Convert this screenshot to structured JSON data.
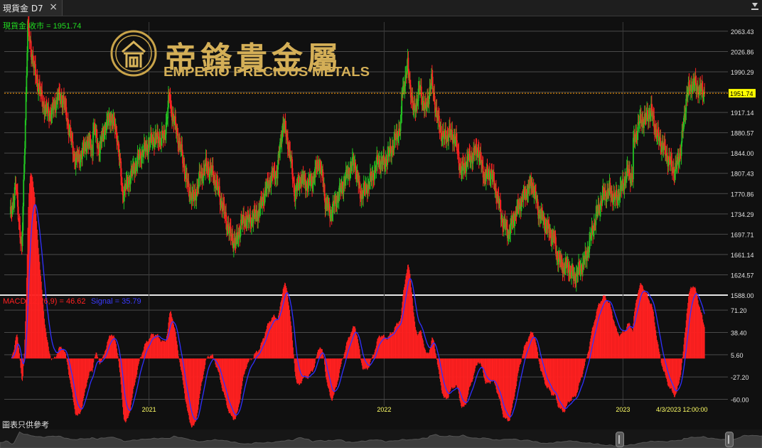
{
  "tab": {
    "title": "現貨金 D7"
  },
  "footnote": "圖表只供參考",
  "chart_data": {
    "type": "candlestick",
    "logo": {
      "cn": "帝鋒貴金屬",
      "en": "EMPERIO PRECIOUS METALS"
    },
    "main_label": "現貨金.收市 = 1951.74",
    "last_price": 1951.74,
    "ylim": [
      1588.0,
      2080.0
    ],
    "y_ticks": [
      2063.43,
      2026.86,
      1990.29,
      1953.71,
      1917.14,
      1880.57,
      1844.0,
      1807.43,
      1770.86,
      1734.29,
      1697.71,
      1661.14,
      1624.57,
      1588.0
    ],
    "price_segments": [
      [
        1727,
        1785,
        1665,
        2070,
        2000,
        1956,
        1920,
        1915,
        1945,
        1940,
        1885,
        1830,
        1840,
        1865,
        1850
      ],
      [
        1850,
        1895,
        1850,
        1890,
        1910,
        1880,
        1770,
        1795,
        1820,
        1840,
        1855,
        1870,
        1870,
        1872,
        1960
      ],
      [
        1960,
        1930,
        1885,
        1840,
        1780,
        1760,
        1800,
        1820,
        1810,
        1780,
        1740,
        1700,
        1680,
        1718,
        1728
      ],
      [
        1728,
        1720,
        1728,
        1740,
        1775,
        1800,
        1810,
        1900,
        1855,
        1770,
        1800,
        1787,
        1795,
        1830,
        1780
      ],
      [
        1780,
        1760,
        1735,
        1760,
        1785,
        1810,
        1830,
        1770,
        1780,
        1800,
        1830,
        1825,
        1845,
        1870,
        1900
      ],
      [
        1900,
        1950,
        2000,
        1915,
        1960,
        1920,
        1975,
        1905,
        1870,
        1880,
        1870,
        1810,
        1830,
        1840,
        1855
      ],
      [
        1855,
        1840,
        1800,
        1810,
        1770,
        1720,
        1700,
        1730,
        1755,
        1775,
        1790,
        1740,
        1720,
        1700,
        1680
      ],
      [
        1680,
        1665,
        1640,
        1640,
        1620,
        1635,
        1655,
        1700,
        1740,
        1770,
        1775,
        1760,
        1780,
        1810,
        1800
      ],
      [
        1800,
        1860,
        1900,
        1905,
        1920,
        1875,
        1855,
        1830,
        1810,
        1850,
        1950,
        1970,
        1960,
        1951.74
      ]
    ],
    "x_labels": [
      "2021",
      "2022",
      "2023"
    ],
    "date_label": "4/3/2023 12:00:00",
    "macd": {
      "label_macd": "MACD(12,26,9) = 46.62",
      "label_signal": "Signal = 35.79",
      "macd_value": 46.62,
      "signal_value": 35.79,
      "ylim": [
        -70,
        85
      ],
      "y_ticks": [
        71.2,
        38.4,
        5.6,
        -27.2,
        -60.0
      ],
      "colors": {
        "histogram": "#ff2020",
        "signal": "#3030ff"
      }
    },
    "colors": {
      "up": "#22c322",
      "down": "#ff2222",
      "last_price_bg": "#ffff00",
      "last_price_line": "#ff9a00"
    },
    "grid": true
  }
}
